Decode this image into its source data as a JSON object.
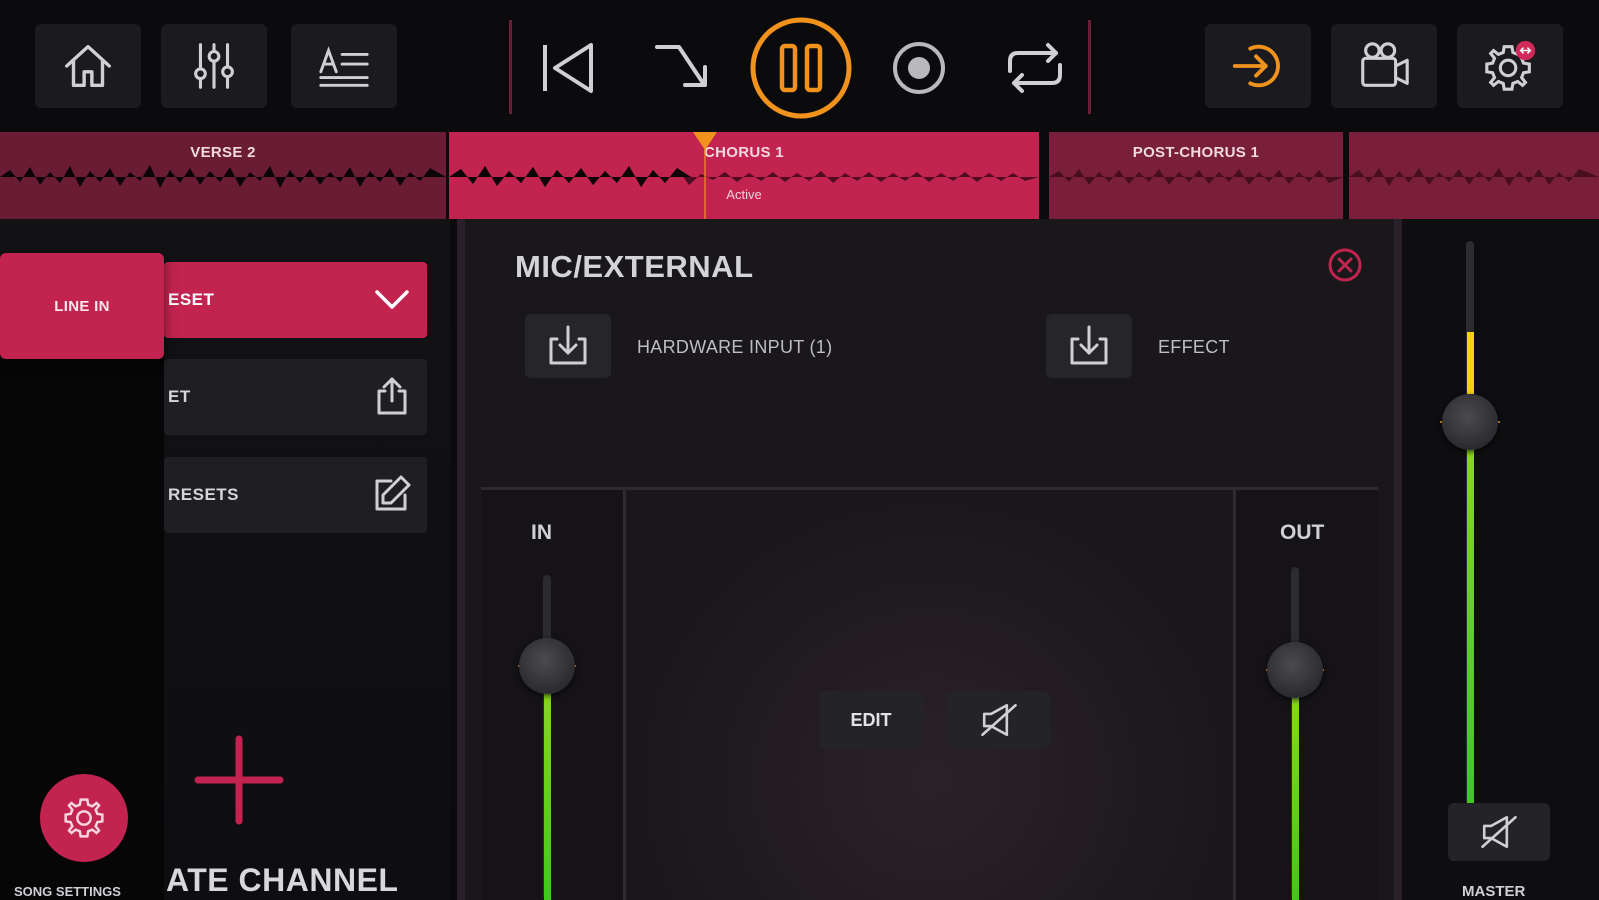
{
  "colors": {
    "accent": "#c2234f",
    "transport_active": "#f0921c",
    "meter_green": "#4fcb1f",
    "meter_yellow": "#f4d20f",
    "record_dot": "#b8b8bd"
  },
  "toolbar": {
    "left_icons": [
      "home-icon",
      "mixer-sliders-icon",
      "lyrics-text-icon"
    ],
    "transport_icons": [
      "skip-back-icon",
      "jump-arrow-icon",
      "pause-icon",
      "record-icon",
      "loop-icon"
    ],
    "right_icons": [
      "input-arrow-icon",
      "camera-icon",
      "gear-icon"
    ]
  },
  "timeline": {
    "sections": [
      {
        "label": "VERSE 2",
        "sub": ""
      },
      {
        "label": "CHORUS 1",
        "sub": "Active"
      },
      {
        "label": "POST-CHORUS 1",
        "sub": ""
      },
      {
        "label": "",
        "sub": ""
      }
    ],
    "playhead_progress": 0.44
  },
  "left_panel": {
    "side_tab": "LINE IN",
    "rows": [
      "ESET",
      "ET",
      "RESETS"
    ],
    "create_label": "ATE CHANNEL",
    "song_settings": "SONG SETTINGS"
  },
  "center": {
    "title": "MIC/EXTERNAL",
    "input_label": "HARDWARE INPUT (1)",
    "effect_label": "EFFECT",
    "in_label": "IN",
    "out_label": "OUT",
    "edit_label": "EDIT",
    "in_level": 0.28,
    "out_level": 0.31
  },
  "right": {
    "master_label": "MASTER",
    "master_level": 0.68
  }
}
